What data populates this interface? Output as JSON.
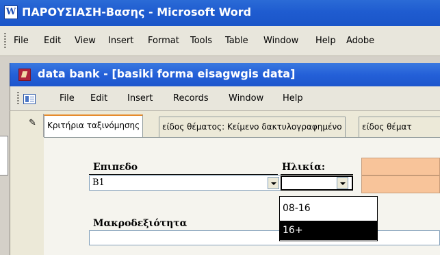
{
  "word": {
    "title": "ΠΑΡΟΥΣΙΑΣΗ-Βασης - Microsoft Word",
    "menu": [
      "File",
      "Edit",
      "View",
      "Insert",
      "Format",
      "Tools",
      "Table",
      "Window",
      "Help",
      "Adobe"
    ]
  },
  "access": {
    "title": "data bank - [basiki forma eisagwgis data]",
    "menu": [
      "File",
      "Edit",
      "Insert",
      "Records",
      "Window",
      "Help"
    ]
  },
  "tabs": [
    "Κριτήρια ταξινόμησης",
    "είδος θέματος: Κείμενο δακτυλογραφημένο",
    "είδος θέματ"
  ],
  "form": {
    "level_label": "Επιπεδο",
    "level_value": "B1",
    "age_label": "Ηλικία:",
    "age_value": "",
    "age_options": [
      "08-16",
      "16+"
    ],
    "age_selected_option": "16+",
    "macro_label": "Μακροδεξιότητα",
    "macro_value": ""
  },
  "colors": {
    "title_bar": "#1f5cd0",
    "tab_highlight": "#e68b2c",
    "peach_field": "#f8c49a"
  }
}
